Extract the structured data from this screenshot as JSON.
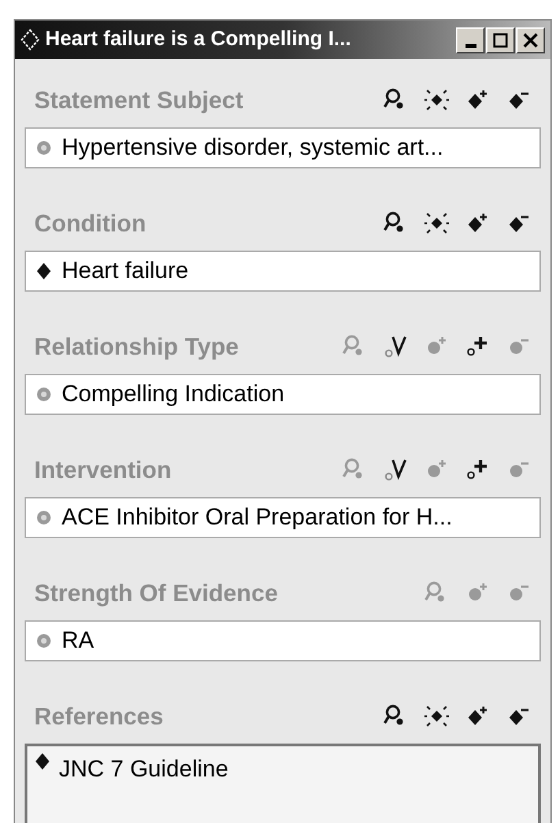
{
  "window": {
    "title": "Heart failure is a Compelling I...",
    "controls": [
      {
        "kind": "minimize"
      },
      {
        "kind": "maximize"
      },
      {
        "kind": "close"
      }
    ]
  },
  "sections": [
    {
      "label": "Statement Subject",
      "kind": "single",
      "value": {
        "kind": "class",
        "text": "Hypertensive disorder, systemic art..."
      },
      "tools": [
        {
          "kind": "search",
          "disabled": false
        },
        {
          "kind": "instance",
          "disabled": false
        },
        {
          "kind": "add",
          "disabled": false
        },
        {
          "kind": "remove",
          "disabled": false
        }
      ]
    },
    {
      "label": "Condition",
      "kind": "single",
      "value": {
        "kind": "individual",
        "text": "Heart failure"
      },
      "tools": [
        {
          "kind": "search",
          "disabled": false
        },
        {
          "kind": "instance",
          "disabled": false
        },
        {
          "kind": "add",
          "disabled": false
        },
        {
          "kind": "remove",
          "disabled": false
        }
      ]
    },
    {
      "label": "Relationship Type",
      "kind": "single",
      "value": {
        "kind": "class",
        "text": "Compelling Indication"
      },
      "tools": [
        {
          "kind": "search",
          "disabled": true
        },
        {
          "kind": "restrict",
          "disabled": false
        },
        {
          "kind": "add",
          "disabled": true
        },
        {
          "kind": "expression",
          "disabled": false
        },
        {
          "kind": "remove",
          "disabled": true
        }
      ]
    },
    {
      "label": "Intervention",
      "kind": "single",
      "value": {
        "kind": "class",
        "text": "ACE Inhibitor Oral Preparation for H..."
      },
      "tools": [
        {
          "kind": "search",
          "disabled": true
        },
        {
          "kind": "restrict",
          "disabled": false
        },
        {
          "kind": "add",
          "disabled": true
        },
        {
          "kind": "expression",
          "disabled": false
        },
        {
          "kind": "remove",
          "disabled": true
        }
      ]
    },
    {
      "label": "Strength Of Evidence",
      "kind": "single",
      "value": {
        "kind": "class",
        "text": "RA"
      },
      "tools": [
        {
          "kind": "search",
          "disabled": true
        },
        {
          "kind": "add",
          "disabled": true
        },
        {
          "kind": "remove",
          "disabled": true
        }
      ]
    },
    {
      "label": "References",
      "kind": "list",
      "value": {
        "kind": "individual",
        "text": "JNC 7 Guideline"
      },
      "tools": [
        {
          "kind": "search",
          "disabled": false
        },
        {
          "kind": "instance",
          "disabled": false
        },
        {
          "kind": "add",
          "disabled": false
        },
        {
          "kind": "remove",
          "disabled": false
        }
      ]
    }
  ]
}
